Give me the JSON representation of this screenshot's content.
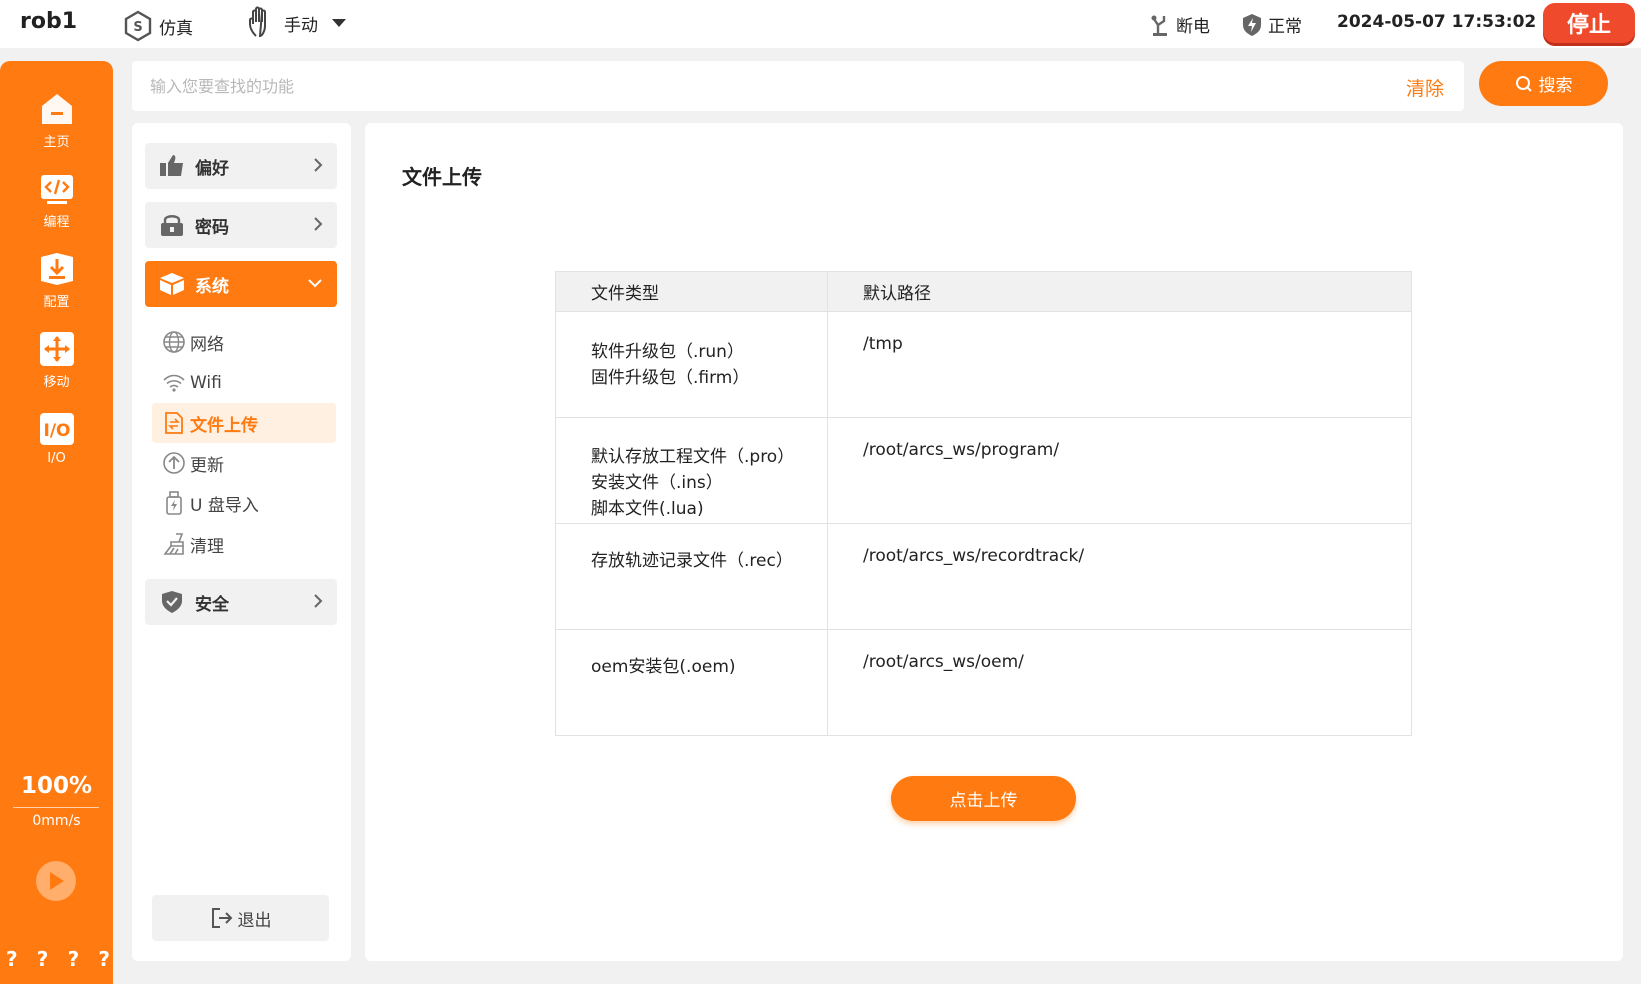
{
  "topbar": {
    "robot_name": "rob1",
    "sim_label": "仿真",
    "manual_label": "手动",
    "power_label": "断电",
    "safety_label": "正常",
    "datetime": "2024-05-07 17:53:02",
    "stop_label": "停止"
  },
  "leftnav": {
    "items": [
      {
        "label": "主页",
        "icon": "home-icon"
      },
      {
        "label": "编程",
        "icon": "code-icon"
      },
      {
        "label": "配置",
        "icon": "config-icon"
      },
      {
        "label": "移动",
        "icon": "move-icon"
      },
      {
        "label": "I/O",
        "icon": "io-icon"
      }
    ],
    "speed_percent": "100%",
    "speed_value": "0mm/s",
    "question_marks": [
      "?",
      "?",
      "?",
      "?"
    ]
  },
  "search": {
    "placeholder": "输入您要查找的功能",
    "clear_label": "清除",
    "button_label": "搜索"
  },
  "menu": {
    "groups": [
      {
        "label": "偏好",
        "icon": "thumbs-up-icon"
      },
      {
        "label": "密码",
        "icon": "lock-icon"
      },
      {
        "label": "系统",
        "icon": "cube-icon"
      },
      {
        "label": "安全",
        "icon": "shield-icon"
      }
    ],
    "system_items": [
      {
        "label": "网络",
        "icon": "globe-icon"
      },
      {
        "label": "Wifi",
        "icon": "wifi-icon"
      },
      {
        "label": "文件上传",
        "icon": "file-upload-icon"
      },
      {
        "label": "更新",
        "icon": "update-icon"
      },
      {
        "label": "U 盘导入",
        "icon": "usb-icon"
      },
      {
        "label": "清理",
        "icon": "broom-icon"
      }
    ],
    "logout_label": "退出"
  },
  "main": {
    "title": "文件上传",
    "table": {
      "headers": [
        "文件类型",
        "默认路径"
      ],
      "rows": [
        {
          "types": [
            "软件升级包（.run）",
            "固件升级包（.firm）"
          ],
          "path": "/tmp"
        },
        {
          "types": [
            "默认存放工程文件（.pro）",
            "安装文件（.ins）",
            "脚本文件(.lua)"
          ],
          "path": "/root/arcs_ws/program/"
        },
        {
          "types": [
            "存放轨迹记录文件（.rec）"
          ],
          "path": "/root/arcs_ws/recordtrack/"
        },
        {
          "types": [
            "oem安装包(.oem)"
          ],
          "path": "/root/arcs_ws/oem/"
        }
      ]
    },
    "upload_label": "点击上传"
  },
  "colors": {
    "accent": "#ff7a10",
    "stop": "#f04a2c",
    "panel_bg": "#f1f1f1"
  }
}
